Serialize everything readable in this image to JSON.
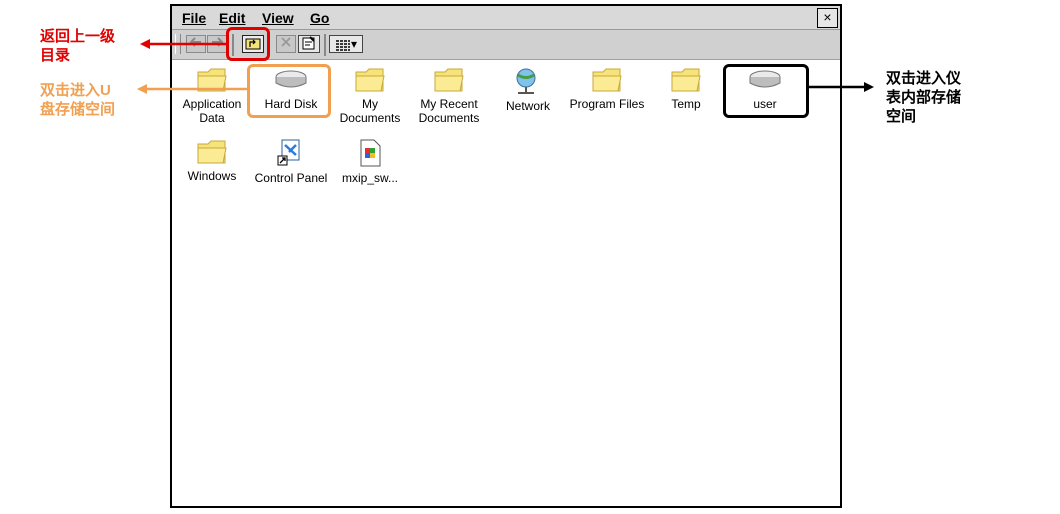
{
  "menu": {
    "file": "File",
    "edit": "Edit",
    "view": "View",
    "go": "Go",
    "close": "×"
  },
  "toolbar": {
    "view_mode_arrow": "▾"
  },
  "items": [
    {
      "label": "Application Data",
      "icon": "folder-icon"
    },
    {
      "label": "Hard Disk",
      "icon": "drive-icon"
    },
    {
      "label": "My Documents",
      "icon": "folder-icon"
    },
    {
      "label": "My Recent Documents",
      "icon": "folder-icon"
    },
    {
      "label": "Network",
      "icon": "network-icon"
    },
    {
      "label": "Program Files",
      "icon": "folder-icon"
    },
    {
      "label": "Temp",
      "icon": "folder-icon"
    },
    {
      "label": "user",
      "icon": "drive-icon"
    },
    {
      "label": "Windows",
      "icon": "folder-icon"
    },
    {
      "label": "Control Panel",
      "icon": "control-panel-icon"
    },
    {
      "label": "mxip_sw...",
      "icon": "file-icon"
    }
  ],
  "annotations": {
    "up_level": "返回上一级\n目录",
    "u_disk": "双击进入U\n盘存储空间",
    "internal": "双击进入仪\n表内部存储\n空间"
  },
  "colors": {
    "red": "#e00000",
    "orange": "#f0a050",
    "black": "#000000"
  }
}
